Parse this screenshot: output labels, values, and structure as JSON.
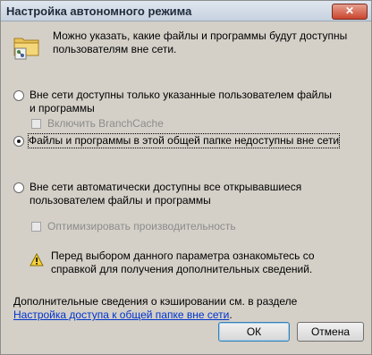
{
  "window": {
    "title": "Настройка автономного режима",
    "close_label": "✕"
  },
  "intro": {
    "icon": "folder-offline-icon",
    "text": "Можно указать, какие файлы и программы будут доступны пользователям вне сети."
  },
  "options": [
    {
      "label": "Вне сети доступны только указанные пользователем файлы и программы",
      "checked": false,
      "suboption": {
        "label": "Включить BranchCache",
        "checked": false,
        "disabled": true
      }
    },
    {
      "label": "Файлы и программы в этой общей папке недоступны вне сети",
      "checked": true
    },
    {
      "label": "Вне сети автоматически доступны все открывавшиеся пользователем файлы и программы",
      "checked": false,
      "suboption": {
        "label": "Оптимизировать производительность",
        "checked": false,
        "disabled": true
      }
    }
  ],
  "warning": {
    "icon": "warning-icon",
    "text": "Перед выбором данного параметра ознакомьтесь со справкой для получения дополнительных сведений."
  },
  "footer": {
    "text": "Дополнительные сведения о кэшировании см. в разделе ",
    "link": "Настройка доступа к общей папке вне сети",
    "end": "."
  },
  "buttons": {
    "ok": "ОК",
    "cancel": "Отмена"
  }
}
